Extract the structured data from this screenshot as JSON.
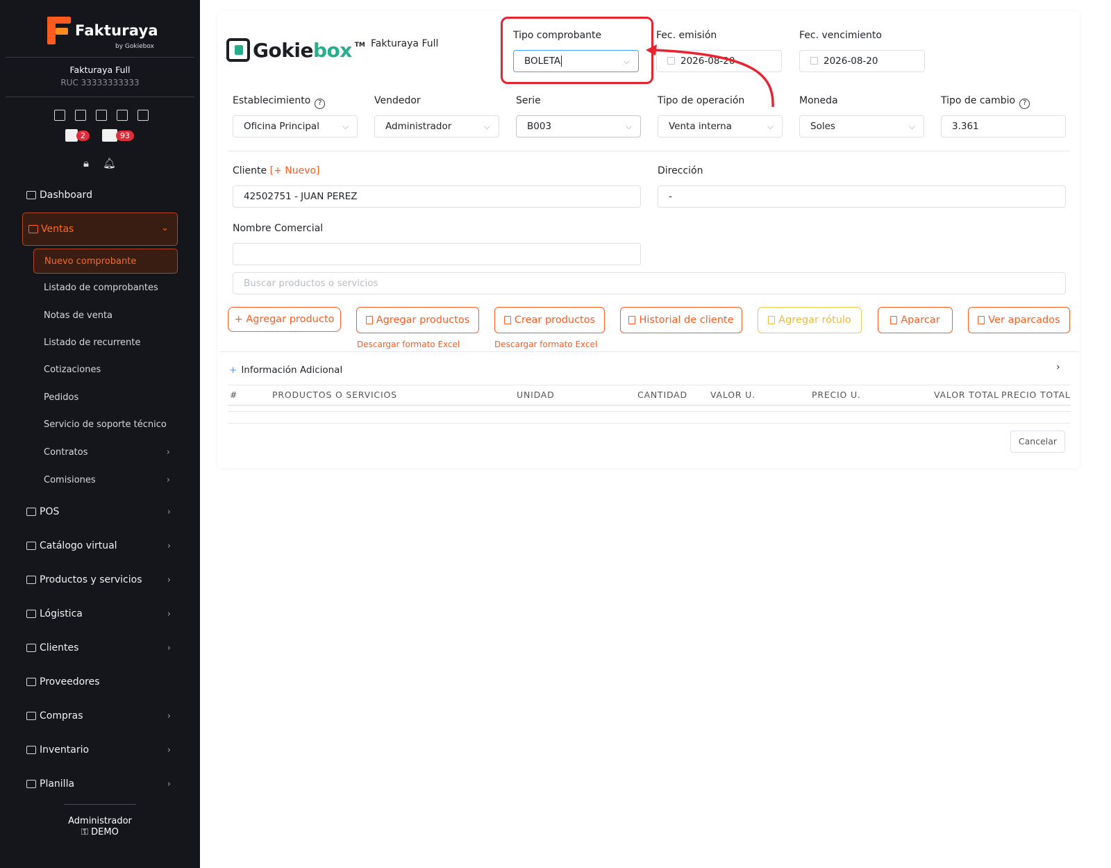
{
  "sidebar": {
    "brand": {
      "name_main": "Fakturaya",
      "name_sub": "by Gokiebox"
    },
    "company": {
      "name": "Fakturaya Full",
      "ruc": "RUC 33333333333"
    },
    "quick_icons": [
      "document-icon",
      "store-icon",
      "calculator-icon",
      "users-icon",
      "box-icon"
    ],
    "badges": [
      {
        "icon": "calendar-x-icon",
        "count": "2"
      },
      {
        "icon": "boxes-icon",
        "count": "93"
      }
    ],
    "nav": {
      "dashboard": "Dashboard",
      "ventas": "Ventas",
      "ventas_items": [
        "Nuevo comprobante",
        "Listado de comprobantes",
        "Notas de venta",
        "Listado de recurrente",
        "Cotizaciones",
        "Pedidos",
        "Servicio de soporte técnico",
        "Contratos",
        "Comisiones"
      ],
      "pos": "POS",
      "catalogo": "Catálogo virtual",
      "productos": "Productos y servicios",
      "logistica": "Lógistica",
      "clientes": "Clientes",
      "proveedores": "Proveedores",
      "compras": "Compras",
      "inventario": "Inventario",
      "planilla": "Planilla"
    },
    "footer": {
      "user": "Administrador",
      "role": "DEMO"
    }
  },
  "main": {
    "logo": {
      "text_a": "Gokie",
      "text_b": "box",
      "tm": "TM"
    },
    "company_title": "Fakturaya Full",
    "tipo_comprobante": {
      "label": "Tipo comprobante",
      "value": "BOLETA"
    },
    "fec_emision": {
      "label": "Fec. emisión",
      "value": "2026-08-20"
    },
    "fec_vencimiento": {
      "label": "Fec. vencimiento",
      "value": "2026-08-20"
    },
    "establecimiento": {
      "label": "Establecimiento",
      "value": "Oficina Principal"
    },
    "vendedor": {
      "label": "Vendedor",
      "value": "Administrador"
    },
    "serie": {
      "label": "Serie",
      "value": "B003"
    },
    "tipo_operacion": {
      "label": "Tipo de operación",
      "value": "Venta interna"
    },
    "moneda": {
      "label": "Moneda",
      "value": "Soles"
    },
    "tipo_cambio": {
      "label": "Tipo de cambio",
      "value": "3.361"
    },
    "cliente": {
      "label": "Cliente",
      "new_link": "[+ Nuevo]",
      "value": "42502751 - JUAN PEREZ"
    },
    "direccion": {
      "label": "Dirección",
      "value": "-"
    },
    "nombre_comercial": {
      "label": "Nombre Comercial",
      "value": ""
    },
    "search": {
      "placeholder": "Buscar productos o servicios"
    },
    "buttons": {
      "agregar_producto": "+ Agregar producto",
      "agregar_productos": "Agregar productos",
      "crear_productos": "Crear productos",
      "historial": "Historial de cliente",
      "agregar_rotulo": "Agregar rótulo",
      "aparcar": "Aparcar",
      "ver_aparcados": "Ver aparcados"
    },
    "download_link": "Descargar formato Excel",
    "info_adicional": "Información Adicional",
    "table_headers": [
      "#",
      "PRODUCTOS O SERVICIOS",
      "UNIDAD",
      "CANTIDAD",
      "VALOR U.",
      "PRECIO U.",
      "VALOR TOTAL",
      "PRECIO TOTAL"
    ],
    "cancel": "Cancelar"
  },
  "colors": {
    "accent": "#ff5a1f",
    "sidebar_bg": "#14161c",
    "highlight": "#e8232f",
    "brand_green": "#25b08d"
  }
}
